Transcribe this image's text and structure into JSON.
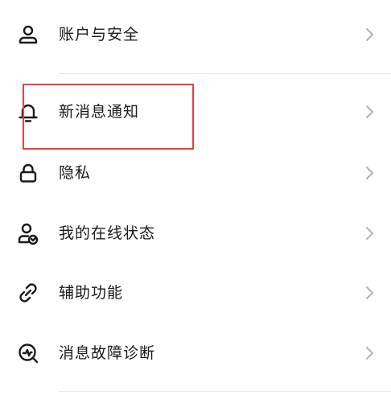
{
  "settings": {
    "items": [
      {
        "label": "账户与安全",
        "icon": "person-icon"
      },
      {
        "label": "新消息通知",
        "icon": "bell-icon"
      },
      {
        "label": "隐私",
        "icon": "lock-icon"
      },
      {
        "label": "我的在线状态",
        "icon": "person-status-icon"
      },
      {
        "label": "辅助功能",
        "icon": "link-icon"
      },
      {
        "label": "消息故障诊断",
        "icon": "diagnose-icon"
      }
    ]
  },
  "colors": {
    "text": "#1a1a1a",
    "icon": "#1a1a1a",
    "chevron": "#b3b3b3",
    "divider": "#e9e9e9",
    "annotation": "#e5404a"
  }
}
